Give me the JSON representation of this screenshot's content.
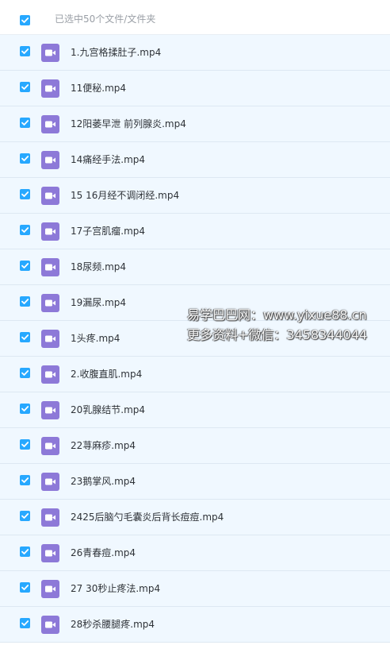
{
  "selection_bar": {
    "label": "已选中50个文件/文件夹",
    "checked": true
  },
  "colors": {
    "checkbox_accent": "#27a8ff",
    "video_icon": "#8d79d8",
    "row_background": "#f0f8ff"
  },
  "files": [
    {
      "name": "1.九宫格揉肚子.mp4",
      "checked": true,
      "icon": "video-file-icon"
    },
    {
      "name": "11便秘.mp4",
      "checked": true,
      "icon": "video-file-icon"
    },
    {
      "name": "12阳萎早泄 前列腺炎.mp4",
      "checked": true,
      "icon": "video-file-icon"
    },
    {
      "name": "14痛经手法.mp4",
      "checked": true,
      "icon": "video-file-icon"
    },
    {
      "name": "15 16月经不调闭经.mp4",
      "checked": true,
      "icon": "video-file-icon"
    },
    {
      "name": "17子宫肌瘤.mp4",
      "checked": true,
      "icon": "video-file-icon"
    },
    {
      "name": "18尿频.mp4",
      "checked": true,
      "icon": "video-file-icon"
    },
    {
      "name": "19漏尿.mp4",
      "checked": true,
      "icon": "video-file-icon"
    },
    {
      "name": "1头疼.mp4",
      "checked": true,
      "icon": "video-file-icon"
    },
    {
      "name": "2.收腹直肌.mp4",
      "checked": true,
      "icon": "video-file-icon"
    },
    {
      "name": "20乳腺结节.mp4",
      "checked": true,
      "icon": "video-file-icon"
    },
    {
      "name": "22荨麻疹.mp4",
      "checked": true,
      "icon": "video-file-icon"
    },
    {
      "name": "23鹅掌风.mp4",
      "checked": true,
      "icon": "video-file-icon"
    },
    {
      "name": "2425后脑勺毛囊炎后背长痘痘.mp4",
      "checked": true,
      "icon": "video-file-icon"
    },
    {
      "name": "26青春痘.mp4",
      "checked": true,
      "icon": "video-file-icon"
    },
    {
      "name": "27 30秒止疼法.mp4",
      "checked": true,
      "icon": "video-file-icon"
    },
    {
      "name": "28秒杀腰腿疼.mp4",
      "checked": true,
      "icon": "video-file-icon"
    }
  ],
  "watermark": {
    "line1": "易学巴巴网：www.yixue88.cn",
    "line2": "更多资料+微信：3458344044"
  }
}
